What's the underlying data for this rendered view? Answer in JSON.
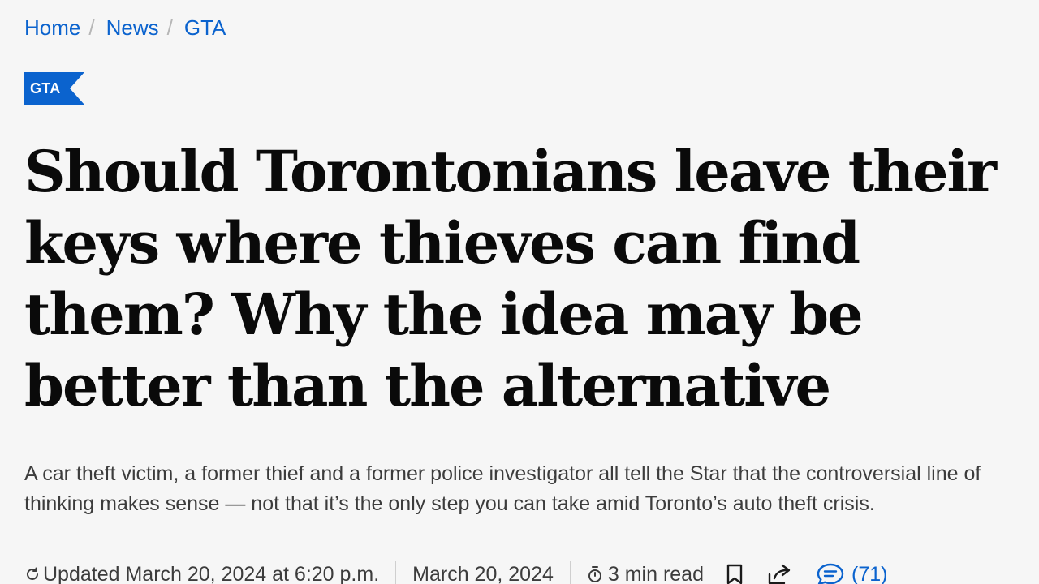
{
  "breadcrumb": {
    "items": [
      {
        "label": "Home"
      },
      {
        "label": "News"
      },
      {
        "label": "GTA"
      }
    ],
    "separator": "/"
  },
  "tag": {
    "label": "GTA",
    "color": "#0b63ce"
  },
  "article": {
    "headline": "Should Torontonians leave their keys where thieves can find them? Why the idea may be better than the alternative",
    "dek": "A car theft victim, a former thief and a former police investigator all tell the Star that the controversial line of thinking makes sense — not that it’s the only step you can take amid Toronto’s auto theft crisis."
  },
  "meta": {
    "updated": "Updated March 20, 2024 at 6:20 p.m.",
    "published": "March 20, 2024",
    "read_time": "3 min read",
    "comments_count": "(71)",
    "icons": {
      "updated": "refresh-icon",
      "read_time": "stopwatch-icon",
      "bookmark": "bookmark-icon",
      "share": "share-icon",
      "comments": "comment-icon"
    }
  },
  "colors": {
    "accent": "#0b63ce",
    "background": "#f6f6f6",
    "headline": "#0a0a0a",
    "body_text": "#3c3c3c"
  }
}
